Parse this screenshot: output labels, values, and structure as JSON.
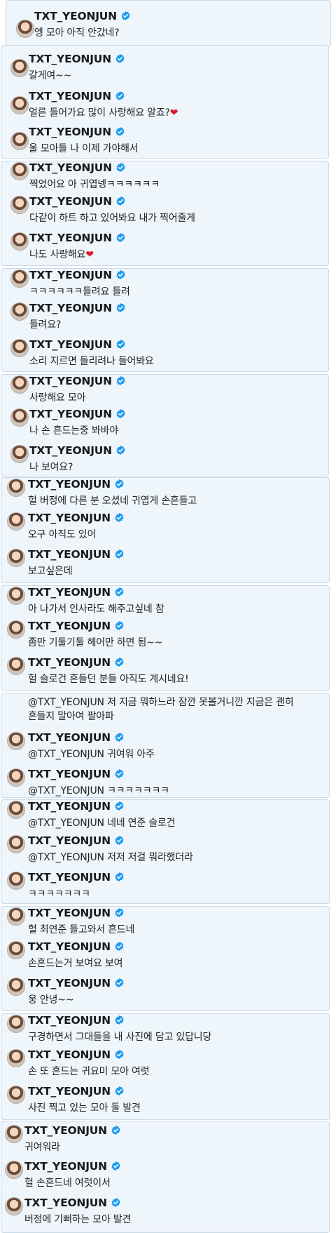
{
  "username": "TXT_YEONJUN",
  "verified_badge_color": "#1d9bf0",
  "panels": [
    {
      "messages": [
        {
          "text": "엥 모아 아직 안갔네?"
        }
      ]
    },
    {
      "messages": [
        {
          "text": "갈게여~~"
        },
        {
          "text": "얼른 들어가요 많이 사랑해요 알죠?",
          "suffix": "❤"
        },
        {
          "text": "울 모아들 나 이제 가야해서"
        }
      ]
    },
    {
      "messages": [
        {
          "text": "찍었어요 아 귀엽넹ㅋㅋㅋㅋㅋㅋ"
        },
        {
          "text": "다같이 하트 하고 있어봐요 내가 찍어줄게"
        },
        {
          "text": "나도 사랑해요",
          "suffix": "❤"
        }
      ]
    },
    {
      "messages": [
        {
          "text": "ㅋㅋㅋㅋㅋㅋ들려요 들려"
        },
        {
          "text": "들려요?"
        },
        {
          "text": "소리 지르면 들리려나 들어봐요"
        }
      ]
    },
    {
      "messages": [
        {
          "text": "사랑해요 모아"
        },
        {
          "text": "나 손 흔드는중 봐바야"
        },
        {
          "text": "나 보여요?"
        }
      ]
    },
    {
      "messages": [
        {
          "text": "헐 버정에 다른 분 오셨네 귀엽게 손흔들고"
        },
        {
          "text": "오구 아직도 있어"
        },
        {
          "text": "보고싶은데"
        }
      ]
    },
    {
      "messages": [
        {
          "text": "아 나가서 인사라도 해주고싶네 참"
        },
        {
          "text": "좀만 기둘기둘 헤어만 하면 됨~~"
        },
        {
          "text": "헐 슬로건 흔들던 분들 아직도 계시네요!"
        }
      ]
    },
    {
      "messages": [
        {
          "mention": "@TXT_YEONJUN",
          "text": "저 지금 뭐하느라 잠깐 못볼거니깐 지금은 괜히",
          "text2": "흔들지 말아여 팔아파",
          "no_header": true
        },
        {
          "mention": "@TXT_YEONJUN",
          "text": "귀여워 아주"
        },
        {
          "mention": "@TXT_YEONJUN",
          "text": "ㅋㅋㅋㅋㅋㅋㅋ"
        }
      ]
    },
    {
      "messages": [
        {
          "mention": "@TXT_YEONJUN",
          "text": "네네 연준 슬로건"
        },
        {
          "mention": "@TXT_YEONJUN",
          "text": "저저 저걸 뭐라했더라"
        },
        {
          "text": "ㅋㅋㅋㅋㅋㅋㅋ"
        }
      ]
    },
    {
      "messages": [
        {
          "text": "헐 최연준 들고와서 흔드네"
        },
        {
          "text": "손흔드는거 보여요 보여"
        },
        {
          "text": "웅 안녕~~"
        }
      ]
    },
    {
      "messages": [
        {
          "text": "구경하면서 그대들을 내 사진에 담고 있답니당"
        },
        {
          "text": "손 또 흔드는 귀요미 모아 여럿"
        },
        {
          "text": "사진 찍고 있는 모아 둘 발견"
        }
      ]
    },
    {
      "messages": [
        {
          "text": "귀여워라"
        },
        {
          "text": "헐 손흔드네 여럿이서"
        },
        {
          "text": "버정에 기뻐하는 모아 발견"
        }
      ]
    }
  ]
}
